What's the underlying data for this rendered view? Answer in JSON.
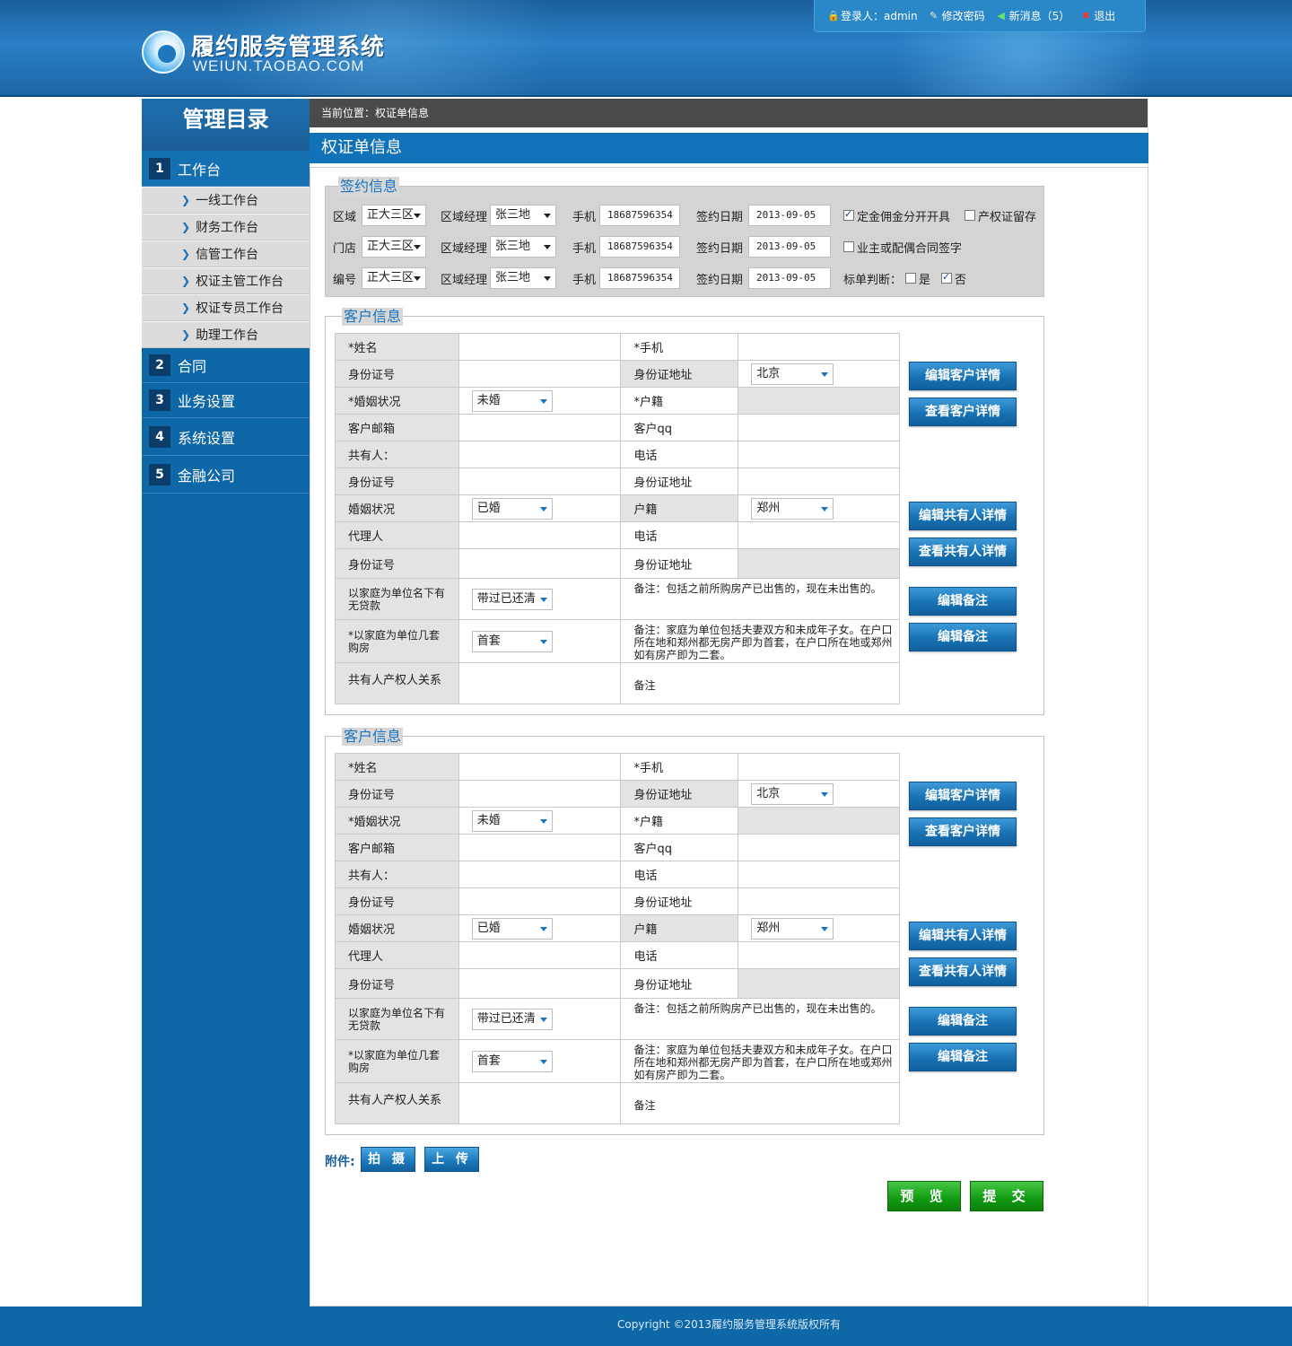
{
  "header": {
    "title": "履约服务管理系统",
    "subtitle": "WEIUN.TAOBAO.COM",
    "login_label": "登录人：admin",
    "change_password": "修改密码",
    "new_messages": "新消息（5）",
    "logout": "退出",
    "icons": {
      "login": "lock-icon",
      "change_password": "edit-icon",
      "new_messages": "message-icon",
      "logout": "close-icon"
    }
  },
  "sidebar": {
    "title": "管理目录",
    "sections": [
      {
        "num": "1",
        "label": "工作台"
      },
      {
        "num": "2",
        "label": "合同"
      },
      {
        "num": "3",
        "label": "业务设置"
      },
      {
        "num": "4",
        "label": "系统设置"
      },
      {
        "num": "5",
        "label": "金融公司"
      }
    ],
    "items": [
      "一线工作台",
      "财务工作台",
      "信管工作台",
      "权证主管工作台",
      "权证专员工作台",
      "助理工作台"
    ]
  },
  "breadcrumb": "当前位置：权证单信息",
  "page_title": "权证单信息",
  "sign": {
    "legend": "签约信息",
    "rows": [
      {
        "label": "区域",
        "area": "正大三区",
        "manager_label": "区域经理",
        "manager": "张三地",
        "phone_label": "手机",
        "phone": "18687596354",
        "date_label": "签约日期",
        "date": "2013-09-05"
      },
      {
        "label": "门店",
        "area": "正大三区",
        "manager_label": "区域经理",
        "manager": "张三地",
        "phone_label": "手机",
        "phone": "18687596354",
        "date_label": "签约日期",
        "date": "2013-09-05"
      },
      {
        "label": "编号",
        "area": "正大三区",
        "manager_label": "区域经理",
        "manager": "张三地",
        "phone_label": "手机",
        "phone": "18687596354",
        "date_label": "签约日期",
        "date": "2013-09-05"
      }
    ],
    "opt_deposit": "定金佣金分开开具",
    "opt_deposit_checked": true,
    "opt_certificate": "产权证留存",
    "opt_certificate_checked": false,
    "opt_owner_sign": "业主或配偶合同签字",
    "opt_owner_sign_checked": false,
    "bid_label": "标单判断：",
    "bid_yes": "是",
    "bid_yes_checked": false,
    "bid_no": "否",
    "bid_no_checked": true
  },
  "customer": {
    "legend": "客户信息",
    "name_label": "*姓名",
    "mobile_label": "*手机",
    "id_label": "身份证号",
    "id_addr_label": "身份证地址",
    "id_addr_value": "北京",
    "marital_label": "*婚姻状况",
    "marital_value": "未婚",
    "hukou_label": "*户籍",
    "email_label": "客户邮箱",
    "qq_label": "客户qq",
    "coowner_label": "共有人：",
    "phone_label": "电话",
    "co_id_label": "身份证号",
    "co_id_addr_label": "身份证地址",
    "co_marital_label": "婚姻状况",
    "co_marital_value": "已婚",
    "co_hukou_label": "户籍",
    "co_hukou_value": "郑州",
    "agent_label": "代理人",
    "agent_phone_label": "电话",
    "agent_id_label": "身份证号",
    "agent_id_addr_label": "身份证地址",
    "loan_label": "以家庭为单位名下有无贷款",
    "loan_value": "带过已还清",
    "loan_note": "备注：包括之前所购房产已出售的，现在未出售的。",
    "house_label": "*以家庭为单位几套购房",
    "house_value": "首套",
    "house_note": "备注：家庭为单位包括夫妻双方和未成年子女。在户口所在地和郑州都无房产即为首套，在户口所在地或郑州如有房产即为二套。",
    "relation_label": "共有人产权人关系",
    "relation_note": "备注",
    "btn_edit_customer": "编辑客户详情",
    "btn_view_customer": "查看客户详情",
    "btn_edit_coowner": "编辑共有人详情",
    "btn_view_coowner": "查看共有人详情",
    "btn_edit_note": "编辑备注"
  },
  "attachment": {
    "label": "附件:",
    "shoot": "拍 摄",
    "upload": "上 传"
  },
  "actions": {
    "preview": "预 览",
    "submit": "提 交"
  },
  "footer": "Copyright ©2013履约服务管理系统版权所有"
}
